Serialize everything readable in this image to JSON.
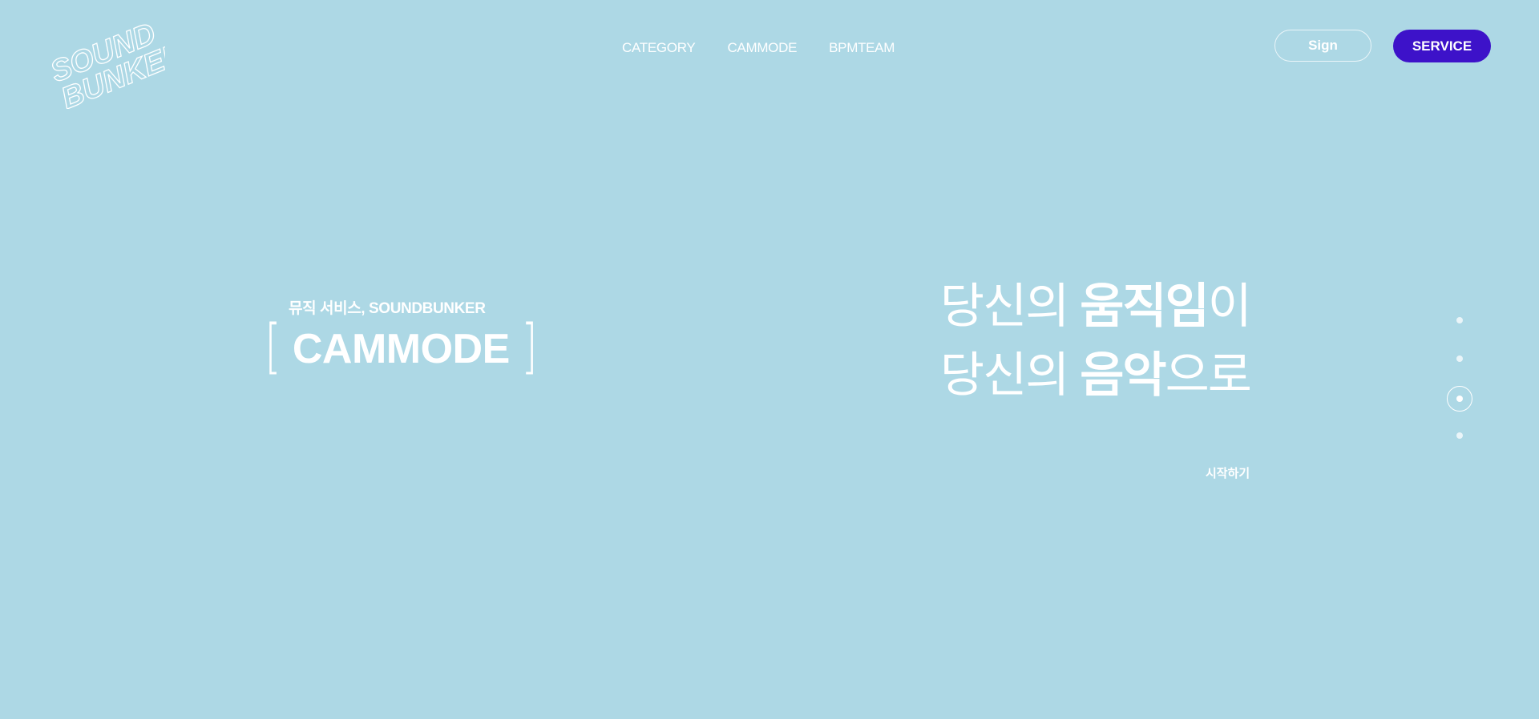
{
  "brand": {
    "logo_line1": "SOUND",
    "logo_line2": "BUNKER",
    "icon": "soundbunker-logo"
  },
  "nav": {
    "items": [
      {
        "label": "CATEGORY"
      },
      {
        "label": "CAMMODE"
      },
      {
        "label": "BPMTEAM"
      }
    ]
  },
  "header": {
    "sign_label": "Sign",
    "service_label": "SERVICE"
  },
  "hero": {
    "subtitle": "뮤직 서비스, SOUNDBUNKER",
    "bracket_open": "[",
    "title": "CAMMODE",
    "bracket_close": "]"
  },
  "headline": {
    "line1_pre": "당신의 ",
    "line1_bold": "움직임",
    "line1_post": "이",
    "line2_pre": "당신의 ",
    "line2_bold": "음악",
    "line2_post": "으로",
    "cta": "시작하기"
  },
  "pagination": {
    "count": 4,
    "active_index": 3
  },
  "colors": {
    "background": "#add8e5",
    "accent": "#3d12c9",
    "text": "#ffffff"
  }
}
